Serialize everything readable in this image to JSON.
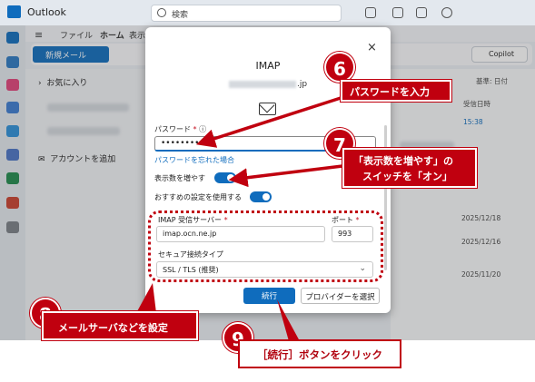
{
  "app": {
    "title": "Outlook",
    "search_placeholder": "検索",
    "ribbon_tabs": [
      "ファイル",
      "ホーム",
      "表示"
    ],
    "new_mail_label": "新規メール",
    "copilot_label": "Copilot",
    "folders": {
      "favorites": "お気に入り",
      "add_account": "アカウントを追加"
    },
    "mail_list": {
      "filter_label": "基準: 日付",
      "sort_label": "受信日時",
      "times": [
        "15:38"
      ],
      "dates": [
        "2025/12/18",
        "2025/12/16",
        "2025/11/20"
      ]
    }
  },
  "dialog": {
    "title": "IMAP",
    "email_domain": ".jp",
    "password_label": "パスワード",
    "required_mark": "*",
    "password_value": "••••••••••",
    "forgot_password_link": "パスワードを忘れた場合",
    "show_more_label": "表示数を増やす",
    "recommended_label": "おすすめの設定を使用する",
    "imap_server_label": "IMAP 受信サーバー",
    "imap_server_value": "imap.ocn.ne.jp",
    "port_label": "ポート",
    "port_value": "993",
    "secure_type_label": "セキュア接続タイプ",
    "secure_type_value": "SSL / TLS (推奨)",
    "continue_button": "続行",
    "choose_provider_button": "プロバイダーを選択",
    "close_symbol": "×"
  },
  "annotations": {
    "step6_number": "6",
    "step6_text": "パスワードを入力",
    "step7_number": "7",
    "step7_text_line1": "「表示数を増やす」の",
    "step7_text_line2": "スイッチを「オン」",
    "step8_number": "8",
    "step8_text": "メールサーバなどを設定",
    "step9_number": "9",
    "step9_text": "［続行］ボタンをクリック",
    "accent_color": "#c0000f"
  }
}
